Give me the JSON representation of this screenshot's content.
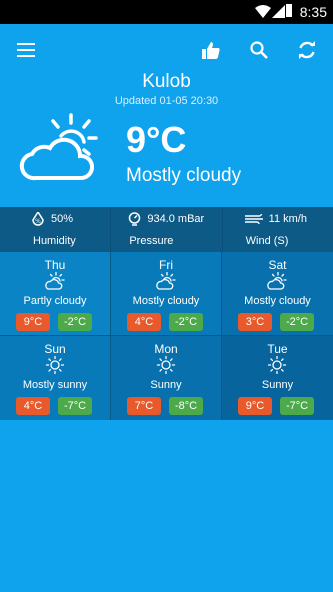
{
  "status_bar": {
    "time": "8:35"
  },
  "location": {
    "city": "Kulob",
    "updated": "Updated 01-05 20:30"
  },
  "current": {
    "temperature": "9°C",
    "condition": "Mostly cloudy",
    "icon": "partly-cloudy-sun-icon"
  },
  "stats": [
    {
      "value": "50%",
      "label": "Humidity",
      "icon": "humidity-icon"
    },
    {
      "value": "934.0 mBar",
      "label": "Pressure",
      "icon": "pressure-gauge-icon"
    },
    {
      "value": "11 km/h",
      "label": "Wind (S)",
      "icon": "wind-icon"
    }
  ],
  "forecast": [
    {
      "day": "Thu",
      "condition": "Partly cloudy",
      "high": "9°C",
      "low": "-2°C",
      "icon": "partly-cloudy-icon"
    },
    {
      "day": "Fri",
      "condition": "Mostly cloudy",
      "high": "4°C",
      "low": "-2°C",
      "icon": "partly-cloudy-icon"
    },
    {
      "day": "Sat",
      "condition": "Mostly cloudy",
      "high": "3°C",
      "low": "-2°C",
      "icon": "partly-cloudy-icon"
    },
    {
      "day": "Sun",
      "condition": "Mostly sunny",
      "high": "4°C",
      "low": "-7°C",
      "icon": "sun-icon"
    },
    {
      "day": "Mon",
      "condition": "Sunny",
      "high": "7°C",
      "low": "-8°C",
      "icon": "sun-icon"
    },
    {
      "day": "Tue",
      "condition": "Sunny",
      "high": "9°C",
      "low": "-7°C",
      "icon": "sun-icon"
    }
  ],
  "colors": {
    "background": "#0fa3ed",
    "high_temp": "#e85a2c",
    "low_temp": "#4caa4a",
    "stats_bar": "#0e5a86"
  }
}
